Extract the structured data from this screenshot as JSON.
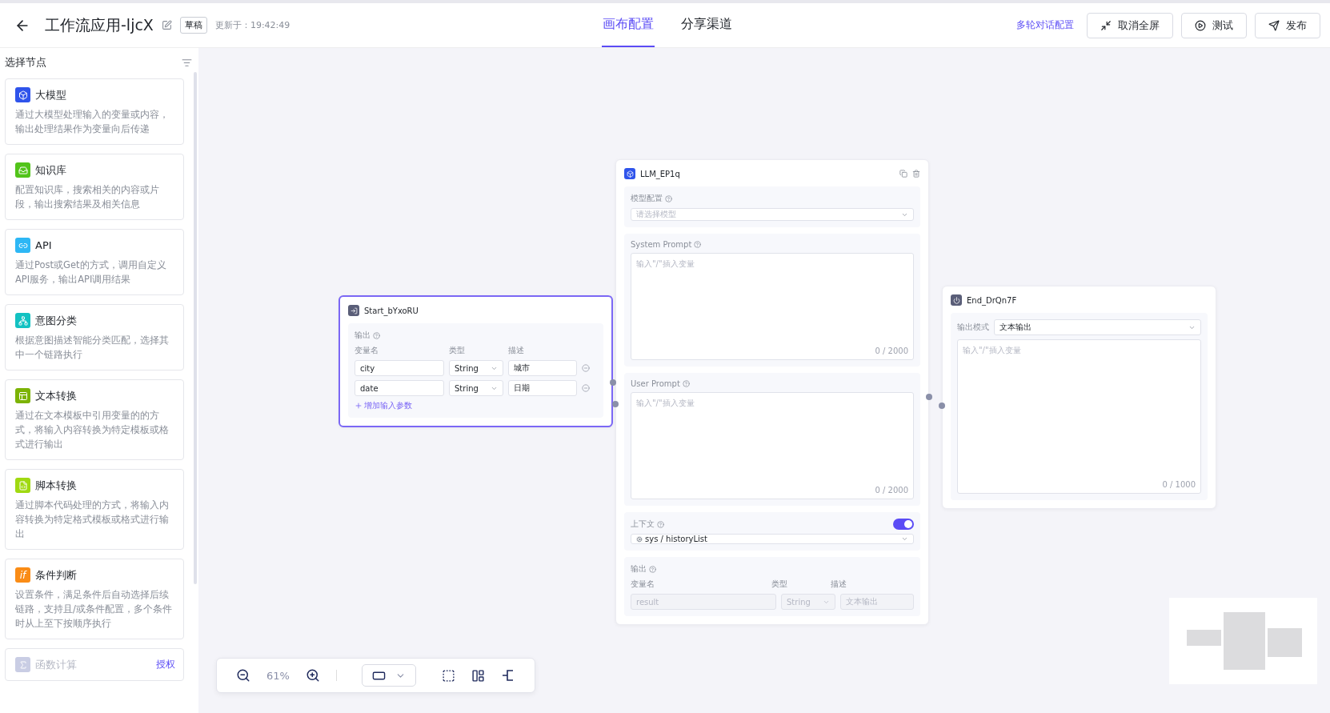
{
  "header": {
    "title": "工作流应用-ljcX",
    "badge": "草稿",
    "updated": "更新于：19:42:49",
    "tabs": [
      {
        "label": "画布配置",
        "selected": true
      },
      {
        "label": "分享渠道",
        "selected": false
      }
    ],
    "link": "多轮对话配置",
    "buttons": [
      {
        "kind": "exit-fullscreen",
        "label": "取消全屏"
      },
      {
        "kind": "test",
        "label": "测试"
      },
      {
        "kind": "publish",
        "label": "发布"
      }
    ]
  },
  "sidebar": {
    "title": "选择节点",
    "items": [
      {
        "kind": "llm",
        "color": "#2f54eb",
        "title": "大模型",
        "desc": "通过大模型处理输入的变量或内容，输出处理结果作为变量向后传递",
        "disabled": false
      },
      {
        "kind": "knowledge",
        "color": "#52c41a",
        "title": "知识库",
        "desc": "配置知识库，搜索相关的内容或片段，输出搜索结果及相关信息",
        "disabled": false
      },
      {
        "kind": "api",
        "color": "#2db7f5",
        "title": "API",
        "desc": "通过Post或Get的方式，调用自定义API服务，输出API调用结果",
        "disabled": false
      },
      {
        "kind": "intent",
        "color": "#13c2c2",
        "title": "意图分类",
        "desc": "根据意图描述智能分类匹配，选择其中一个链路执行",
        "disabled": false
      },
      {
        "kind": "template",
        "color": "#7cb305",
        "title": "文本转换",
        "desc": "通过在文本模板中引用变量的的方式，将输入内容转换为特定模板或格式进行输出",
        "disabled": false
      },
      {
        "kind": "script",
        "color": "#a0d911",
        "title": "脚本转换",
        "desc": "通过脚本代码处理的方式，将输入内容转换为特定格式模板或格式进行输出",
        "disabled": false
      },
      {
        "kind": "condition",
        "color": "#fa8c16",
        "icon_text": "if",
        "title": "条件判断",
        "desc": "设置条件，满足条件后自动选择后续链路，支持且/或条件配置，多个条件时从上至下按顺序执行",
        "disabled": false
      },
      {
        "kind": "function",
        "color": "#c9cde4",
        "title": "函数计算",
        "badge": "授权",
        "disabled": true
      }
    ]
  },
  "start": {
    "title": "Start_bYxoRU",
    "output_label": "输出",
    "columns": [
      "变量名",
      "类型",
      "描述"
    ],
    "params": [
      {
        "name": "city",
        "type": "String",
        "desc": "城市"
      },
      {
        "name": "date",
        "type": "String",
        "desc": "日期"
      }
    ],
    "add_label": "增加输入参数"
  },
  "llm": {
    "title": "LLM_EP1q",
    "model": {
      "label": "模型配置",
      "placeholder": "请选择模型"
    },
    "system_prompt": {
      "label": "System Prompt",
      "placeholder": "输入\"/\"插入变量",
      "counter": "0 / 2000"
    },
    "user_prompt": {
      "label": "User Prompt",
      "placeholder": "输入\"/\"插入变量",
      "counter": "0 / 2000"
    },
    "context": {
      "label": "上下文",
      "on": true,
      "value": "sys / historyList"
    },
    "output": {
      "label": "输出",
      "columns": [
        "变量名",
        "类型",
        "描述"
      ],
      "name": "result",
      "type": "String",
      "desc": "文本输出"
    }
  },
  "end": {
    "title": "End_DrQn7F",
    "mode_label": "输出模式",
    "mode": "文本输出",
    "placeholder": "输入\"/\"插入变量",
    "counter": "0 / 1000"
  },
  "toolbar": {
    "zoom": "61%"
  }
}
